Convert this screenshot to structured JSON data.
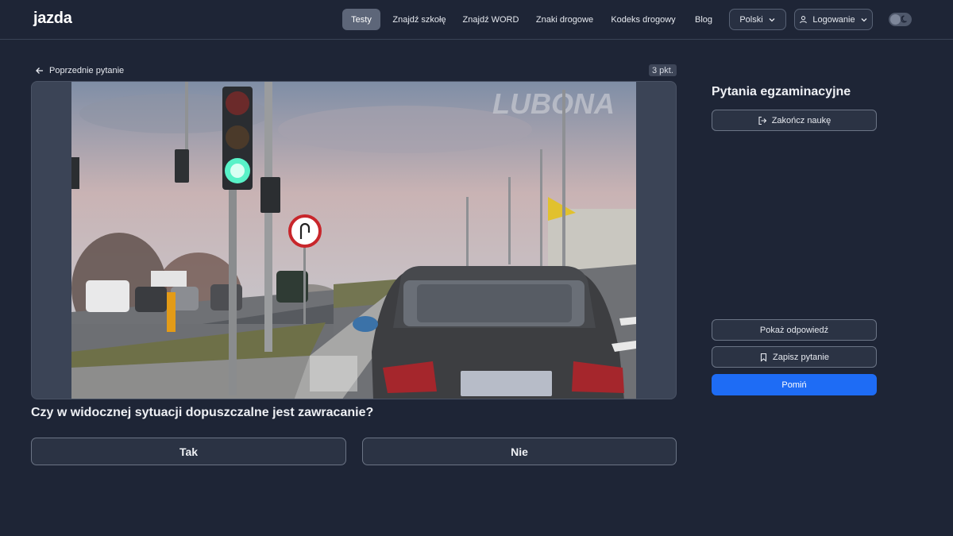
{
  "header": {
    "logo_text": "jazda",
    "nav": [
      {
        "label": "Testy",
        "active": true
      },
      {
        "label": "Znajdź szkołę",
        "active": false
      },
      {
        "label": "Znajdź WORD",
        "active": false
      },
      {
        "label": "Znaki drogowe",
        "active": false
      },
      {
        "label": "Kodeks drogowy",
        "active": false
      },
      {
        "label": "Blog",
        "active": false
      }
    ],
    "language": "Polski",
    "login": "Logowanie",
    "theme_toggle_icon": "moon-icon"
  },
  "main": {
    "prev_label": "Poprzednie pytanie",
    "points": "3 pkt.",
    "image_watermark": "LUBONA",
    "question": "Czy w widocznej sytuacji dopuszczalne jest zawracanie?",
    "answers": [
      "Tak",
      "Nie"
    ]
  },
  "sidebar": {
    "title": "Pytania egzaminacyjne",
    "finish": "Zakończ naukę",
    "show_answer": "Pokaż odpowiedź",
    "save_question": "Zapisz pytanie",
    "skip": "Pomiń"
  },
  "colors": {
    "background": "#1e2536",
    "primary": "#1e6cf5",
    "logo_accent": "#3d8bff"
  }
}
